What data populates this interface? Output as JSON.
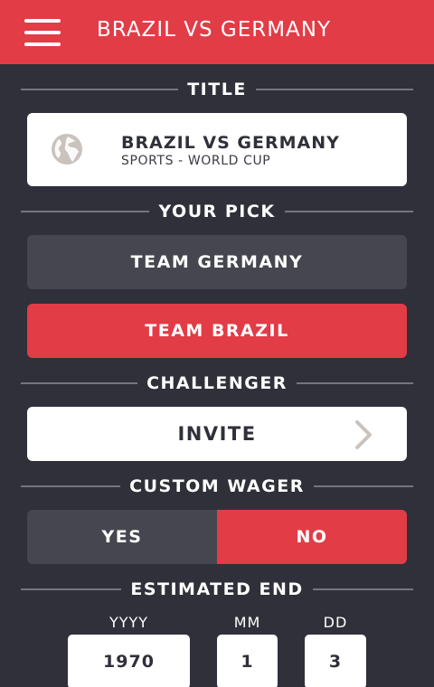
{
  "header": {
    "title": "BRAZIL VS GERMANY",
    "background_color": "#e23c47"
  },
  "sections": {
    "title": "TITLE",
    "your_pick": "YOUR PICK",
    "challenger": "CHALLENGER",
    "custom_wager": "CUSTOM WAGER",
    "estimated_end": "ESTIMATED END"
  },
  "title_card": {
    "icon": "globe-icon",
    "name": "BRAZIL VS GERMANY",
    "subtitle": "SPORTS - WORLD CUP"
  },
  "pick": {
    "options": [
      "TEAM GERMANY",
      "TEAM BRAZIL"
    ],
    "selected": "TEAM BRAZIL"
  },
  "challenger": {
    "invite_label": "INVITE",
    "icon": "chevron-right-icon"
  },
  "custom_wager": {
    "yes_label": "YES",
    "no_label": "NO",
    "selected": "NO"
  },
  "estimated_end": {
    "year_label": "YYYY",
    "month_label": "MM",
    "day_label": "DD",
    "year": "1970",
    "month": "1",
    "day": "3"
  },
  "colors": {
    "accent": "#e23c47",
    "background": "#2f3039",
    "unselected": "#45464f"
  }
}
